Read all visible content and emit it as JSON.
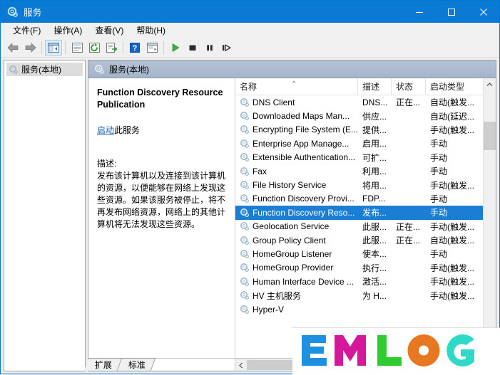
{
  "window": {
    "title": "服务",
    "icon": "services-gear-icon",
    "controls": {
      "minimize": "minimize-icon",
      "maximize": "maximize-icon",
      "close": "close-icon"
    },
    "accent_color": "#0b7ad4"
  },
  "menubar": {
    "items": [
      {
        "label": "文件(F)",
        "name": "menu-file"
      },
      {
        "label": "操作(A)",
        "name": "menu-action"
      },
      {
        "label": "查看(V)",
        "name": "menu-view"
      },
      {
        "label": "帮助(H)",
        "name": "menu-help"
      }
    ]
  },
  "toolbar": {
    "buttons": [
      {
        "name": "back-icon"
      },
      {
        "name": "forward-icon"
      },
      {
        "name": "show-hide-tree-icon"
      },
      {
        "name": "properties-icon"
      },
      {
        "name": "refresh-icon"
      },
      {
        "name": "export-list-icon"
      },
      {
        "name": "help-icon"
      },
      {
        "name": "show-console-tree-icon"
      },
      {
        "name": "start-service-icon"
      },
      {
        "name": "stop-service-icon"
      },
      {
        "name": "pause-service-icon"
      },
      {
        "name": "restart-service-icon"
      }
    ]
  },
  "tree": {
    "items": [
      {
        "label": "服务(本地)",
        "icon": "services-gear-icon",
        "selected": true
      }
    ]
  },
  "right_pane": {
    "header": "服务(本地)",
    "header_icon": "services-gear-icon"
  },
  "detail": {
    "service_title": "Function Discovery Resource Publication",
    "action_link": "启动",
    "action_suffix": "此服务",
    "description_label": "描述:",
    "description_text": "发布该计算机以及连接到该计算机的资源，以便能够在网络上发现这些资源。如果该服务被停止，将不再发布网络资源，网络上的其他计算机将无法发现这些资源。"
  },
  "list": {
    "columns": [
      {
        "label": "名称",
        "key": "name",
        "sorted": "asc",
        "sort_glyph": "⌃"
      },
      {
        "label": "描述",
        "key": "desc"
      },
      {
        "label": "状态",
        "key": "state"
      },
      {
        "label": "启动类型",
        "key": "start"
      }
    ],
    "rows": [
      {
        "name": "DNS Client",
        "desc": "DNS...",
        "state": "正在...",
        "start": "自动(触发...",
        "selected": false
      },
      {
        "name": "Downloaded Maps Man...",
        "desc": "供应...",
        "state": "",
        "start": "自动(延迟...",
        "selected": false
      },
      {
        "name": "Encrypting File System (E...",
        "desc": "提供...",
        "state": "",
        "start": "手动(触发...",
        "selected": false
      },
      {
        "name": "Enterprise App Manage...",
        "desc": "启用...",
        "state": "",
        "start": "手动",
        "selected": false
      },
      {
        "name": "Extensible Authentication...",
        "desc": "可扩...",
        "state": "",
        "start": "手动",
        "selected": false
      },
      {
        "name": "Fax",
        "desc": "利用...",
        "state": "",
        "start": "手动",
        "selected": false
      },
      {
        "name": "File History Service",
        "desc": "将用...",
        "state": "",
        "start": "手动(触发...",
        "selected": false
      },
      {
        "name": "Function Discovery Provi...",
        "desc": "FDP...",
        "state": "",
        "start": "手动",
        "selected": false
      },
      {
        "name": "Function Discovery Reso...",
        "desc": "发布...",
        "state": "",
        "start": "手动",
        "selected": true
      },
      {
        "name": "Geolocation Service",
        "desc": "此服...",
        "state": "正在...",
        "start": "手动(触发...",
        "selected": false
      },
      {
        "name": "Group Policy Client",
        "desc": "此服...",
        "state": "正在...",
        "start": "自动(触发...",
        "selected": false
      },
      {
        "name": "HomeGroup Listener",
        "desc": "使本...",
        "state": "",
        "start": "手动",
        "selected": false
      },
      {
        "name": "HomeGroup Provider",
        "desc": "执行...",
        "state": "",
        "start": "手动(触发...",
        "selected": false
      },
      {
        "name": "Human Interface Device ...",
        "desc": "激活...",
        "state": "",
        "start": "手动(触发...",
        "selected": false
      },
      {
        "name": "HV 主机服务",
        "desc": "为 H...",
        "state": "",
        "start": "手动(触发...",
        "selected": false
      },
      {
        "name": "Hyper-V",
        "desc": "",
        "state": "",
        "start": "",
        "selected": false
      }
    ],
    "vscroll": {
      "up": "scroll-up-icon",
      "down": "scroll-down-icon"
    },
    "hscroll": {
      "left": "scroll-left-icon"
    }
  },
  "tabs": [
    {
      "label": "扩展",
      "name": "tab-extended",
      "active": false
    },
    {
      "label": "标准",
      "name": "tab-standard",
      "active": true
    }
  ],
  "watermark": {
    "text": "EMLOG",
    "letters": [
      {
        "char": "E",
        "color": "#1e90e0"
      },
      {
        "char": "M",
        "color": "#d4179b"
      },
      {
        "char": "L",
        "color": "#2ecc2e"
      },
      {
        "char": "O",
        "color": "#e87722"
      },
      {
        "char": "G",
        "color": "#2ed9c8"
      }
    ]
  }
}
